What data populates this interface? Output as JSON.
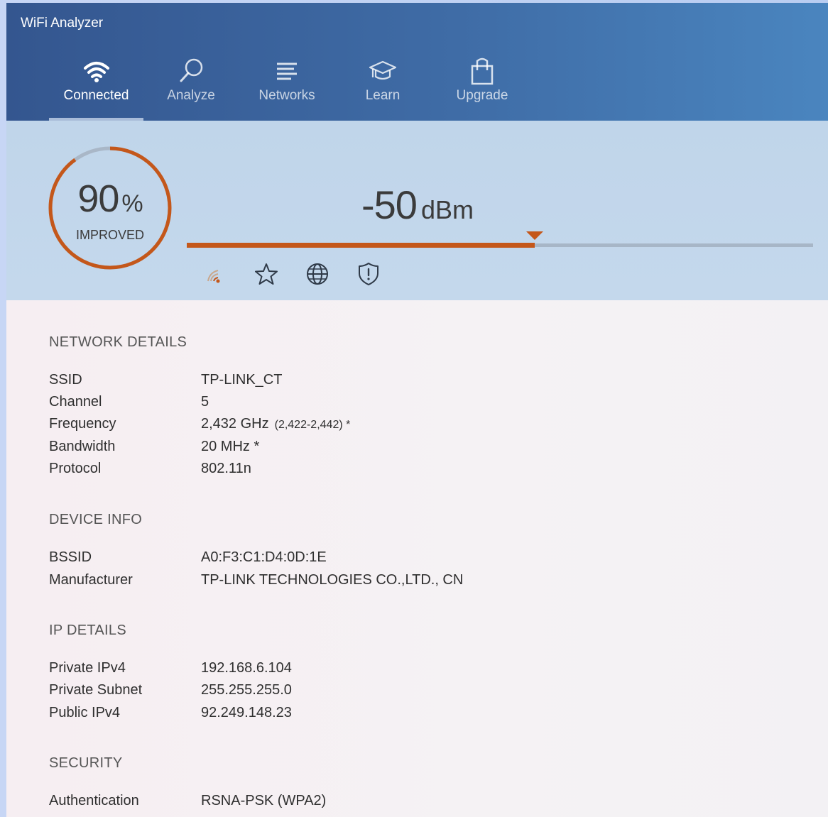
{
  "app": {
    "title": "WiFi Analyzer"
  },
  "nav": [
    {
      "label": "Connected",
      "icon": "wifi-icon",
      "active": true
    },
    {
      "label": "Analyze",
      "icon": "magnifier-icon",
      "active": false
    },
    {
      "label": "Networks",
      "icon": "list-icon",
      "active": false
    },
    {
      "label": "Learn",
      "icon": "graduation-cap-icon",
      "active": false
    },
    {
      "label": "Upgrade",
      "icon": "shopping-bag-icon",
      "active": false
    }
  ],
  "signal": {
    "percent": "90",
    "percent_unit": "%",
    "percent_fraction": 0.9,
    "caption": "IMPROVED",
    "dbm_value": "-50",
    "dbm_unit": "dBm",
    "meter_level": 0.555,
    "accent_color": "#c4571a"
  },
  "status_icons": [
    "signal-strength-icon",
    "star-icon",
    "globe-icon",
    "shield-alert-icon"
  ],
  "sections": {
    "network": {
      "title": "NETWORK DETAILS",
      "rows": [
        {
          "label": "SSID",
          "value": "TP-LINK_CT"
        },
        {
          "label": "Channel",
          "value": "5"
        },
        {
          "label": "Frequency",
          "value": "2,432 GHz",
          "sub": "(2,422-2,442) *"
        },
        {
          "label": "Bandwidth",
          "value": "20 MHz *"
        },
        {
          "label": "Protocol",
          "value": "802.11n"
        }
      ]
    },
    "device": {
      "title": "DEVICE INFO",
      "rows": [
        {
          "label": "BSSID",
          "value": "A0:F3:C1:D4:0D:1E"
        },
        {
          "label": "Manufacturer",
          "value": "TP-LINK TECHNOLOGIES CO.,LTD., CN"
        }
      ]
    },
    "ip": {
      "title": "IP DETAILS",
      "rows": [
        {
          "label": "Private IPv4",
          "value": "192.168.6.104"
        },
        {
          "label": "Private Subnet",
          "value": "255.255.255.0"
        },
        {
          "label": "Public IPv4",
          "value": "92.249.148.23"
        }
      ]
    },
    "security": {
      "title": "SECURITY",
      "rows": [
        {
          "label": "Authentication",
          "value": "RSNA-PSK (WPA2)"
        }
      ]
    }
  }
}
